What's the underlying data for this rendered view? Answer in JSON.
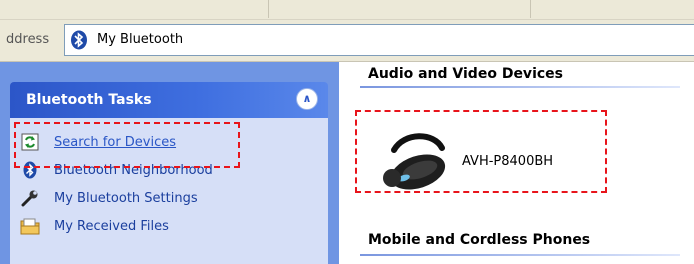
{
  "address": {
    "label": "ddress",
    "value": "My Bluetooth"
  },
  "tasks": {
    "title": "Bluetooth Tasks",
    "items": [
      {
        "label": "Search for Devices",
        "icon": "refresh-icon"
      },
      {
        "label": "Bluetooth Neighborhood",
        "icon": "bluetooth-icon"
      },
      {
        "label": "My Bluetooth Settings",
        "icon": "wrench-icon"
      },
      {
        "label": "My Received Files",
        "icon": "folder-icon"
      }
    ]
  },
  "content": {
    "groups": [
      {
        "title": "Audio and Video Devices"
      },
      {
        "title": "Mobile and Cordless Phones"
      }
    ],
    "device": {
      "label": "AVH-P8400BH",
      "icon": "headset-icon"
    }
  },
  "colors": {
    "pane_bg": "#6f95e3",
    "task_body": "#d6dff7",
    "highlight": "#e8141b",
    "link": "#2a56c6"
  }
}
